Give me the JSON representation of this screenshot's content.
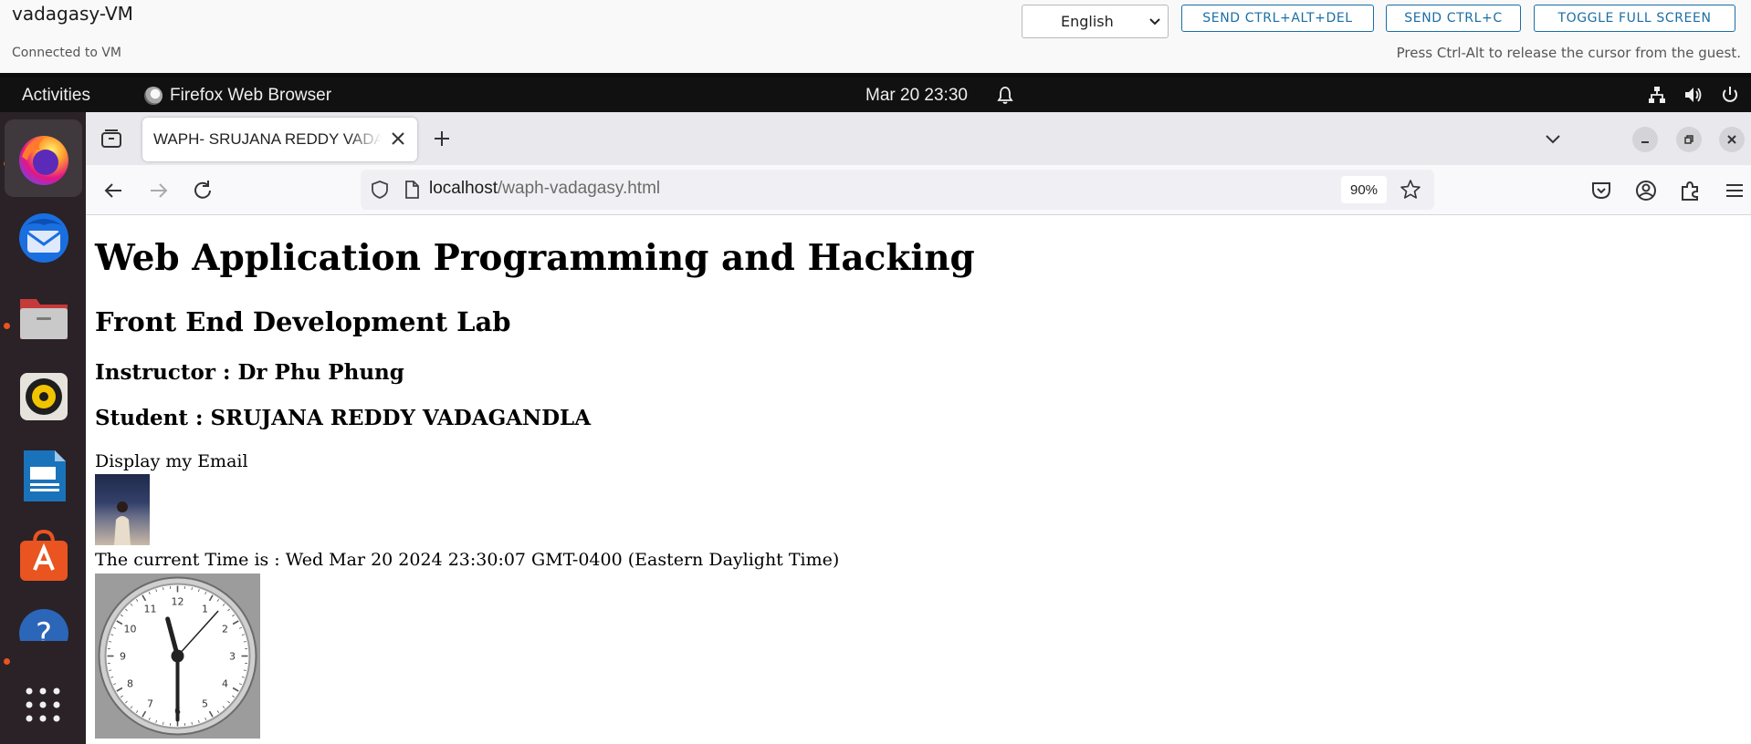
{
  "vm": {
    "title": "vadagasy-VM",
    "status": "Connected to VM",
    "hint": "Press Ctrl-Alt to release the cursor from the guest.",
    "language": "English",
    "buttons": {
      "ctrl_alt_del": "SEND CTRL+ALT+DEL",
      "ctrl_c": "SEND CTRL+C",
      "full_screen": "TOGGLE FULL SCREEN"
    }
  },
  "topbar": {
    "activities": "Activities",
    "app_name": "Firefox Web Browser",
    "datetime": "Mar 20  23:30"
  },
  "dock": {
    "items": [
      "Firefox",
      "Thunderbird",
      "Files",
      "Rhythmbox",
      "LibreOffice Impress",
      "Ubuntu Software",
      "Help",
      "Show Applications"
    ]
  },
  "browser": {
    "tab_title": "WAPH- SRUJANA REDDY VADAGANDLA",
    "url_host": "localhost",
    "url_path": "/waph-vadagasy.html",
    "zoom": "90%"
  },
  "page": {
    "heading1": "Web Application Programming and Hacking",
    "heading2": "Front End Development Lab",
    "instructor": "Instructor : Dr Phu Phung",
    "student": "Student : SRUJANA REDDY VADAGANDLA",
    "email_link": "Display my Email",
    "time_text": "The current Time is : Wed Mar 20 2024 23:30:07 GMT-0400 (Eastern Daylight Time)",
    "clock_numbers": [
      "12",
      "1",
      "2",
      "3",
      "4",
      "5",
      "6",
      "7",
      "8",
      "9",
      "10",
      "11"
    ]
  }
}
